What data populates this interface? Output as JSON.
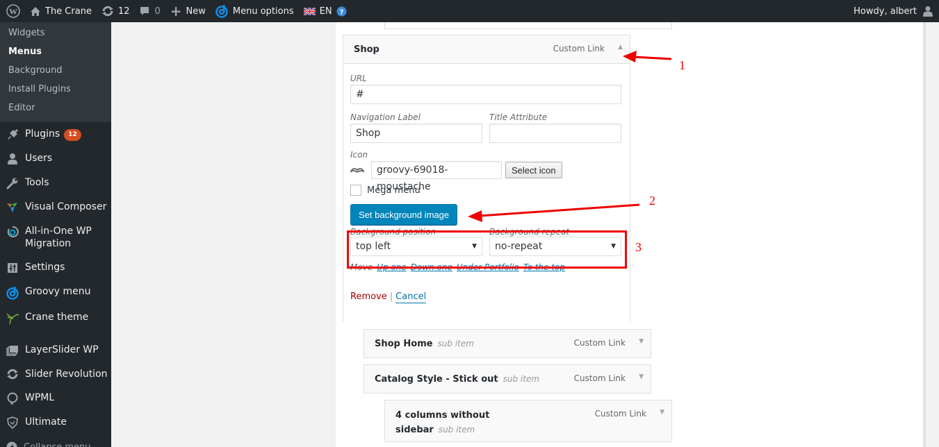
{
  "admin_bar": {
    "wp_logo": "wordpress-logo",
    "site_name": "The Crane",
    "updates_count": "12",
    "comments_count": "0",
    "new_label": "New",
    "menu_options_label": "Menu options",
    "language": "EN",
    "greeting": "Howdy, albert"
  },
  "sidebar": {
    "submenu": [
      {
        "label": "Widgets",
        "current": false
      },
      {
        "label": "Menus",
        "current": true
      },
      {
        "label": "Background",
        "current": false
      },
      {
        "label": "Install Plugins",
        "current": false
      },
      {
        "label": "Editor",
        "current": false
      }
    ],
    "items": [
      {
        "label": "Plugins",
        "icon": "plugin-icon",
        "badge": "12"
      },
      {
        "label": "Users",
        "icon": "users-icon"
      },
      {
        "label": "Tools",
        "icon": "tools-icon"
      },
      {
        "label": "Visual Composer",
        "icon": "visual-composer-icon"
      },
      {
        "label": "All-in-One WP Migration",
        "icon": "migration-icon"
      },
      {
        "label": "Settings",
        "icon": "settings-icon"
      },
      {
        "label": "Groovy menu",
        "icon": "groovy-menu-icon"
      },
      {
        "label": "Crane theme",
        "icon": "crane-icon"
      },
      {
        "label": "LayerSlider WP",
        "icon": "layerslider-icon"
      },
      {
        "label": "Slider Revolution",
        "icon": "slider-revolution-icon"
      },
      {
        "label": "WPML",
        "icon": "wpml-icon"
      },
      {
        "label": "Ultimate",
        "icon": "ultimate-icon"
      }
    ],
    "collapse_label": "Collapse menu"
  },
  "shop_item": {
    "title": "Shop",
    "type": "Custom Link",
    "url_label": "URL",
    "url_value": "#",
    "nav_label_label": "Navigation Label",
    "nav_label_value": "Shop",
    "title_attr_label": "Title Attribute",
    "title_attr_value": "",
    "icon_label": "Icon",
    "icon_value": "groovy-69018-moustache",
    "select_icon_label": "Select icon",
    "mega_menu_label": "Mega menu",
    "mega_menu_checked": false,
    "set_bg_label": "Set background image",
    "bg_position_label": "Background position",
    "bg_position_value": "top left",
    "bg_repeat_label": "Background repeat",
    "bg_repeat_value": "no-repeat",
    "move_label": "Move",
    "move_links": [
      "Up one",
      "Down one",
      "Under Portfolio",
      "To the top"
    ],
    "remove_label": "Remove",
    "separator": "|",
    "cancel_label": "Cancel"
  },
  "sub_items": [
    {
      "title": "Shop Home",
      "note": "sub item",
      "type": "Custom Link"
    },
    {
      "title": "Catalog Style - Stick out",
      "note": "sub item",
      "type": "Custom Link"
    },
    {
      "title": "4 columns without sidebar",
      "note": "sub item",
      "type": "Custom Link"
    }
  ],
  "annotations": [
    "1",
    "2",
    "3"
  ],
  "colors": {
    "admin_dark": "#23282d",
    "submenu_bg": "#32373c",
    "primary_button": "#0085ba",
    "badge": "#d54e21",
    "annotation_red": "#ee0000",
    "link": "#0073aa",
    "remove": "#aa0000"
  }
}
